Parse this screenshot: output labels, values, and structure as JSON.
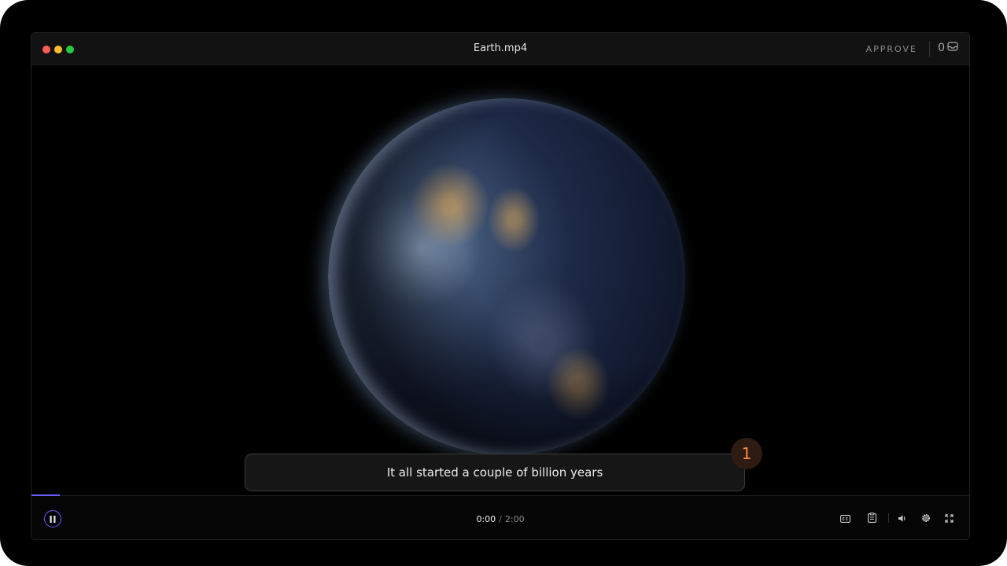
{
  "window": {
    "title": "Earth.mp4",
    "approve_label": "APPROVE",
    "inbox_count": "0"
  },
  "video": {
    "caption": "It all started a couple of billion years",
    "marker_number": "1",
    "progress_fraction": 0.03
  },
  "controls": {
    "current_time": "0:00",
    "separator": "/",
    "duration": "2:00",
    "icons": [
      "pause-icon",
      "closed-captions-icon",
      "clipboard-icon",
      "volume-icon",
      "settings-icon",
      "fullscreen-icon"
    ]
  },
  "colors": {
    "accent": "#6a5cff",
    "marker": "#ff8a3d",
    "marker_bg": "#2e1c12"
  }
}
